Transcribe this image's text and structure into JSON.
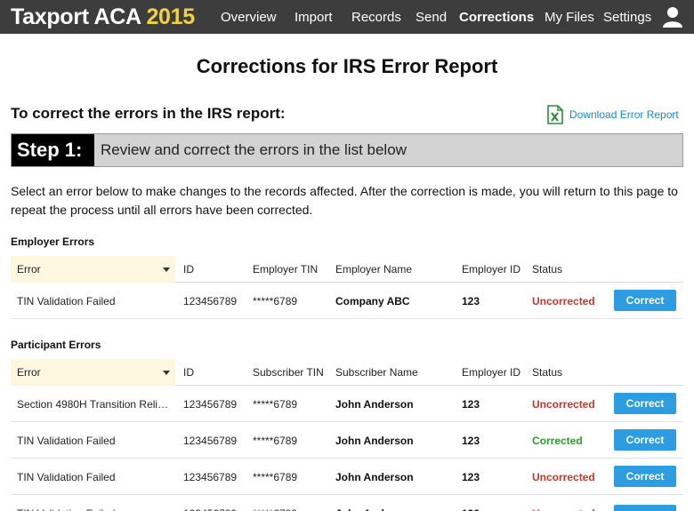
{
  "app": {
    "name": "Taxport ACA",
    "year": "2015"
  },
  "nav": [
    "Overview",
    "Import",
    "Records",
    "Send",
    "Corrections",
    "My Files",
    "Settings"
  ],
  "nav_active": "Corrections",
  "colors": {
    "topbar": "#3d3d3d",
    "accent_year": "#f1d23c",
    "button": "#2b9de0",
    "uncorrected": "#c0392b",
    "corrected": "#2e9c2e"
  },
  "page_title": "Corrections for IRS Error Report",
  "subhead": "To correct the errors in the IRS report:",
  "download_label": "Download Error Report",
  "download_icon": "excel-file-icon",
  "step": {
    "label": "Step 1:",
    "text": "Review and correct the errors in the list below"
  },
  "intro": "Select an error below to make changes to the records affected. After the correction is made, you will return to this page to repeat the process until all errors have been corrected.",
  "employer": {
    "title": "Employer Errors",
    "headers": [
      "Error",
      "ID",
      "Employer TIN",
      "Employer Name",
      "Employer ID",
      "Status"
    ],
    "rows": [
      {
        "error": "TIN Validation Failed",
        "id": "123456789",
        "tin": "*****6789",
        "name": "Company ABC",
        "emp_id": "123",
        "status": "Uncorrected",
        "action": "Correct"
      }
    ]
  },
  "participant": {
    "title": "Participant Errors",
    "headers": [
      "Error",
      "ID",
      "Subscriber TIN",
      "Subscriber Name",
      "Employer ID",
      "Status"
    ],
    "rows": [
      {
        "error": "Section 4980H Transition Relief…",
        "id": "123456789",
        "tin": "*****6789",
        "name": "John Anderson",
        "emp_id": "123",
        "status": "Uncorrected",
        "action": "Correct"
      },
      {
        "error": "TIN Validation Failed",
        "id": "123456789",
        "tin": "*****6789",
        "name": "John Anderson",
        "emp_id": "123",
        "status": "Corrected",
        "action": "Correct"
      },
      {
        "error": "TIN Validation Failed",
        "id": "123456789",
        "tin": "*****6789",
        "name": "John Anderson",
        "emp_id": "123",
        "status": "Uncorrected",
        "action": "Correct"
      }
    ]
  }
}
